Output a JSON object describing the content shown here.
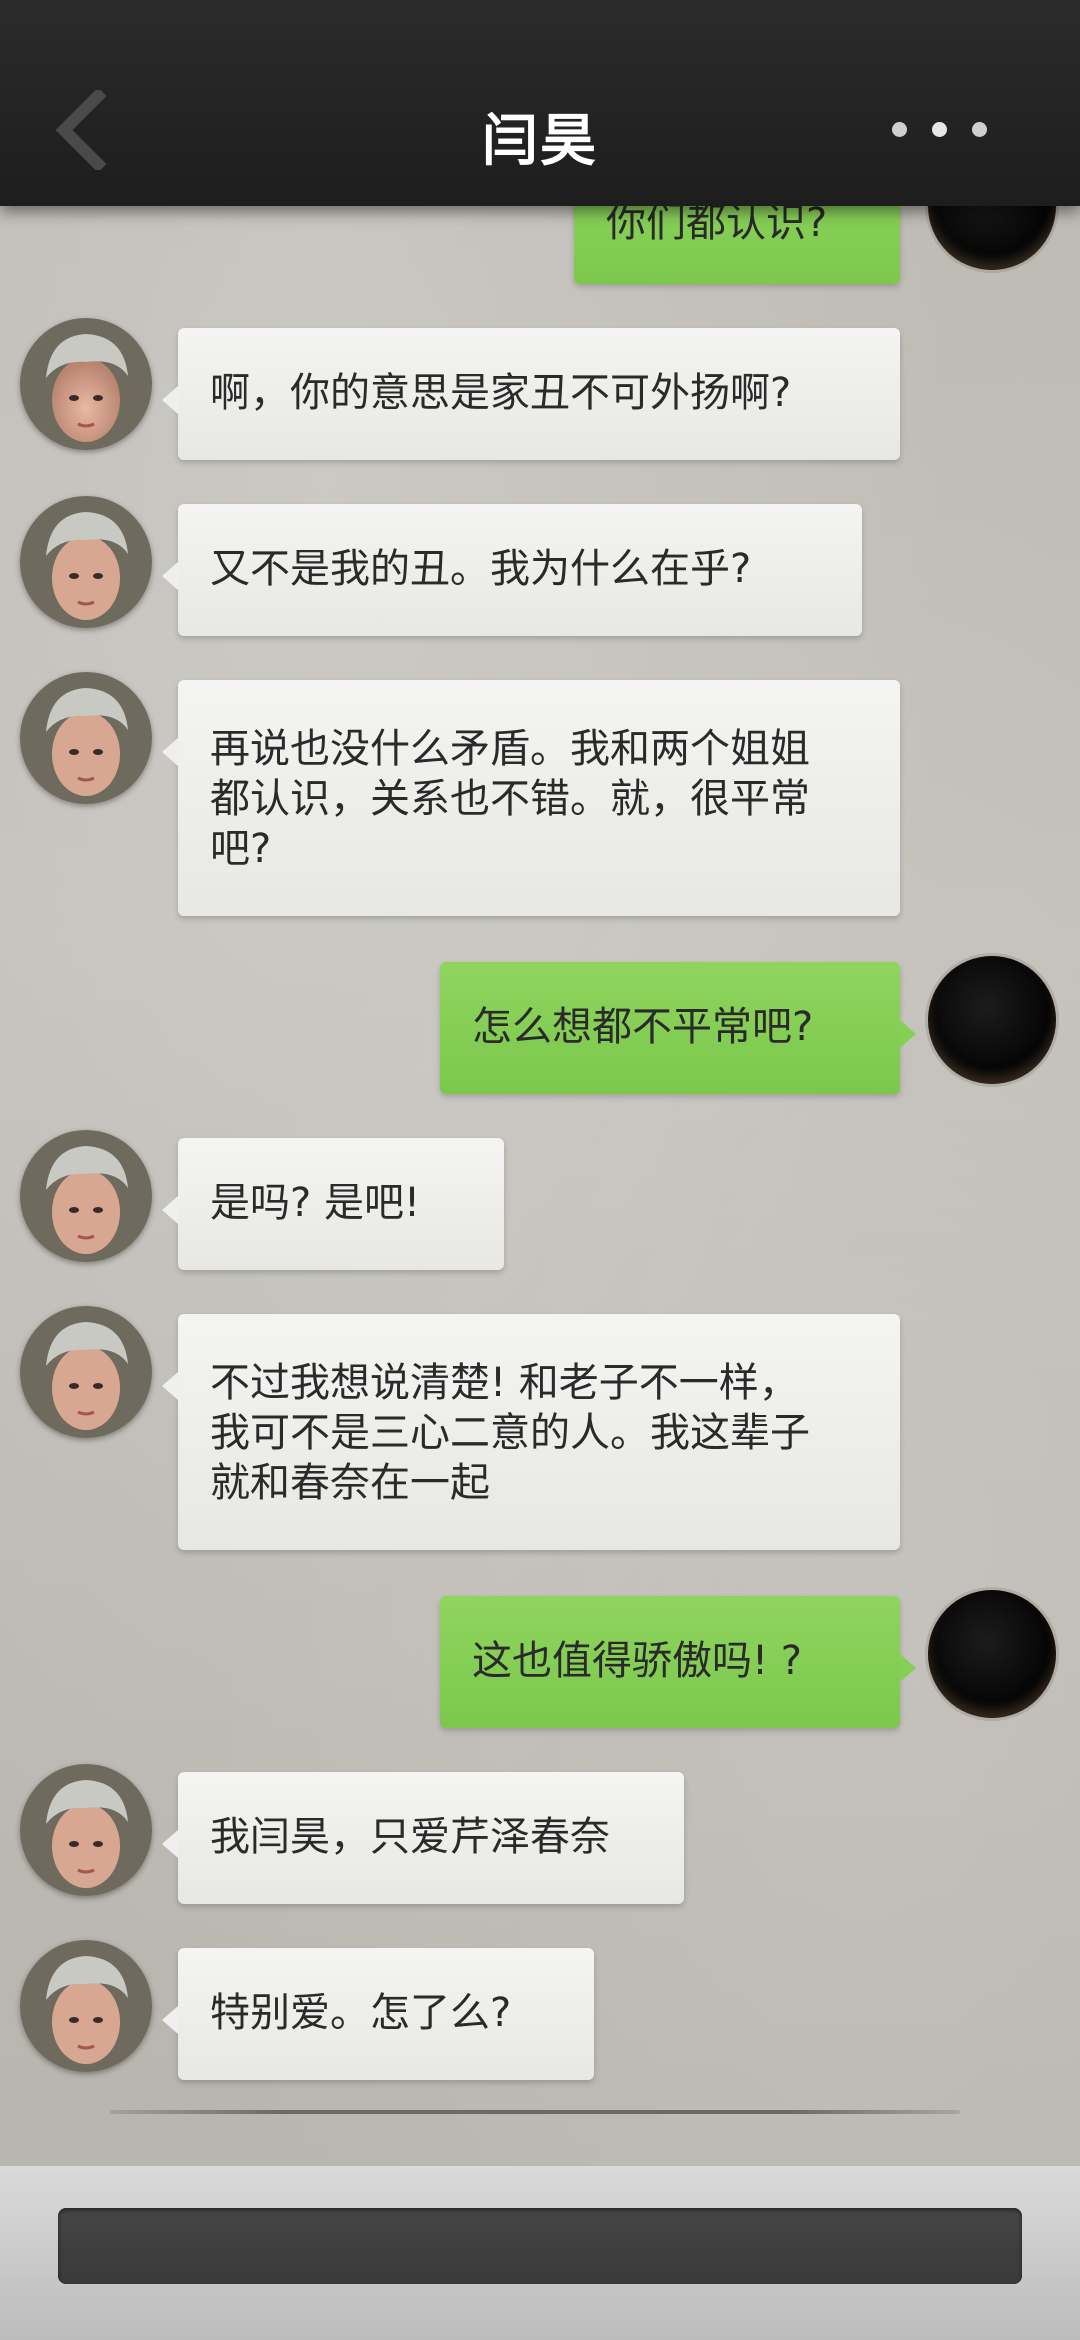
{
  "header": {
    "title": "闫昊",
    "back_icon": "chevron-left-icon",
    "more_icon": "more-dots-icon"
  },
  "messages": [
    {
      "side": "right",
      "lines": [
        "你们都认识?"
      ],
      "partial": true
    },
    {
      "side": "left",
      "lines": [
        "啊，你的意思是家丑不可外扬啊?"
      ]
    },
    {
      "side": "left",
      "lines": [
        "又不是我的丑。我为什么在乎?"
      ]
    },
    {
      "side": "left",
      "lines": [
        "再说也没什么矛盾。我和两个姐姐",
        "都认识，关系也不错。就，很平常",
        "吧?"
      ]
    },
    {
      "side": "right",
      "lines": [
        "怎么想都不平常吧?"
      ]
    },
    {
      "side": "left",
      "lines": [
        "是吗? 是吧!"
      ]
    },
    {
      "side": "left",
      "lines": [
        "不过我想说清楚! 和老子不一样，",
        "我可不是三心二意的人。我这辈子",
        "就和春奈在一起"
      ]
    },
    {
      "side": "right",
      "lines": [
        "这也值得骄傲吗! ?"
      ]
    },
    {
      "side": "left",
      "lines": [
        "我闫昊，只爱芹泽春奈"
      ]
    },
    {
      "side": "left",
      "lines": [
        "特别爱。怎了么?"
      ]
    }
  ],
  "colors": {
    "header_bg": "#1f1f1f",
    "left_bubble": "#ececea",
    "right_bubble": "#86cf55",
    "input_bar": "#404040"
  }
}
